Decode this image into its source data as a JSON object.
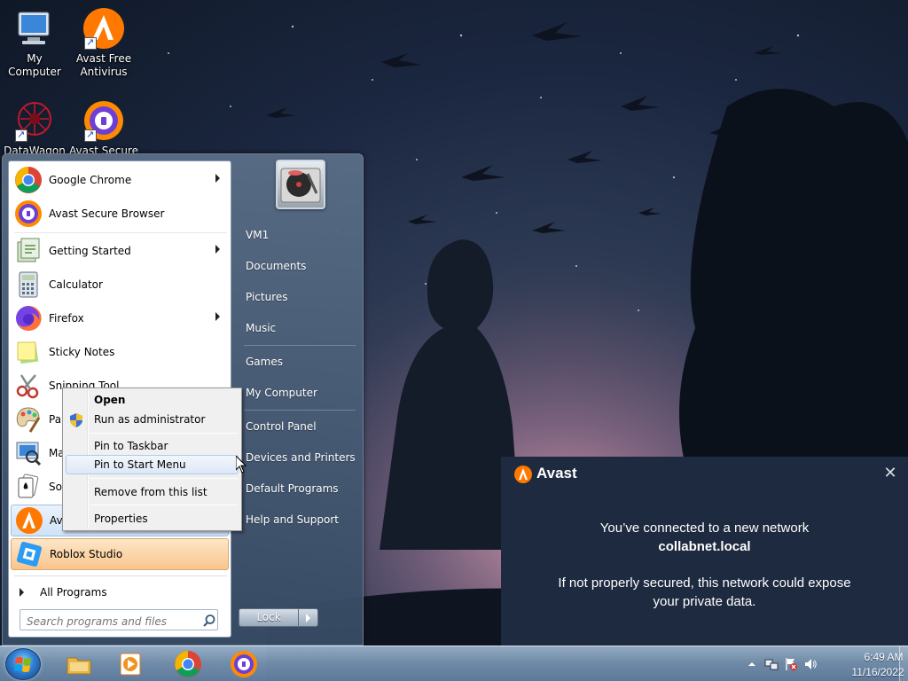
{
  "desktop": {
    "icons": [
      {
        "label_line1": "My Computer",
        "label_line2": ""
      },
      {
        "label_line1": "Avast Free",
        "label_line2": "Antivirus"
      },
      {
        "label_line1": "DataWagon",
        "label_line2": ""
      },
      {
        "label_line1": "Avast Secure",
        "label_line2": ""
      }
    ]
  },
  "start_menu": {
    "programs": [
      {
        "label": "Google Chrome",
        "icon": "chrome-icon",
        "has_submenu": true
      },
      {
        "label": "Avast Secure Browser",
        "icon": "avast-browser-icon",
        "has_submenu": false
      },
      {
        "label": "Getting Started",
        "icon": "getting-started-icon",
        "has_submenu": true
      },
      {
        "label": "Calculator",
        "icon": "calculator-icon",
        "has_submenu": false
      },
      {
        "label": "Firefox",
        "icon": "firefox-icon",
        "has_submenu": true
      },
      {
        "label": "Sticky Notes",
        "icon": "sticky-notes-icon",
        "has_submenu": false
      },
      {
        "label": "Snipping Tool",
        "icon": "snipping-tool-icon",
        "has_submenu": false
      },
      {
        "label": "Pair",
        "icon": "paint-icon",
        "has_submenu": false
      },
      {
        "label": "Mag",
        "icon": "magnifier-icon",
        "has_submenu": false
      },
      {
        "label": "Soli",
        "icon": "solitaire-icon",
        "has_submenu": false
      },
      {
        "label": "Ava",
        "icon": "avast-icon",
        "has_submenu": false
      },
      {
        "label": "Roblox Studio",
        "icon": "roblox-studio-icon",
        "has_submenu": false
      }
    ],
    "all_programs_label": "All Programs",
    "search_placeholder": "Search programs and files",
    "right_items": [
      "VM1",
      "Documents",
      "Pictures",
      "Music",
      "Games",
      "My Computer",
      "Control Panel",
      "Devices and Printers",
      "Default Programs",
      "Help and Support"
    ],
    "lock_label": "Lock"
  },
  "context_menu": {
    "items": [
      {
        "label": "Open",
        "bold": true
      },
      {
        "label": "Run as administrator",
        "bold": false
      },
      {
        "label": "Pin to Taskbar",
        "bold": false
      },
      {
        "label": "Pin to Start Menu",
        "bold": false
      },
      {
        "label": "Remove from this list",
        "bold": false
      },
      {
        "label": "Properties",
        "bold": false
      }
    ]
  },
  "notification": {
    "brand": "Avast",
    "line1": "You’ve connected to a new network",
    "network_name": "collabnet.local",
    "line3a": "If not properly secured, this network could expose",
    "line3b": "your private data.",
    "close_glyph": "✕",
    "accent_color": "#ff7800",
    "background_color": "#1e2a3f"
  },
  "taskbar": {
    "pinned": [
      "explorer-icon",
      "media-player-icon",
      "chrome-icon",
      "avast-secure-browser-icon"
    ],
    "clock_time": "6:49 AM",
    "clock_date": "11/16/2022"
  }
}
